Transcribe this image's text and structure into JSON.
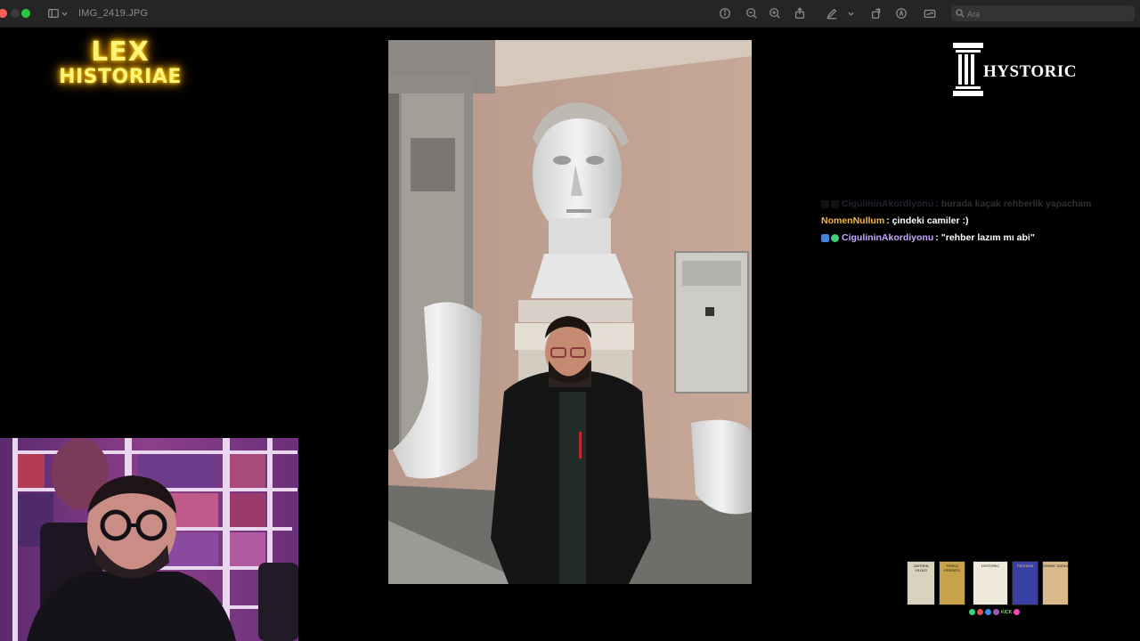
{
  "window": {
    "filename": "IMG_2419.JPG",
    "search_placeholder": "Ara",
    "toolbar_icons": [
      "info-icon",
      "zoom-out-icon",
      "zoom-in-icon",
      "share-icon",
      "markup-pen-icon",
      "rotate-icon",
      "markup-circle-icon",
      "sign-icon"
    ]
  },
  "overlay": {
    "logo_left_line1": "LEX",
    "logo_left_line2": "HISTORIAE",
    "logo_right_text": "HYSTORIC"
  },
  "chat": {
    "messages": [
      {
        "user": "CigulininAkordiyonu",
        "text": "burada kaçak rehberlik yapacham",
        "user_color": "#c7a8ff",
        "faded": true
      },
      {
        "user": "NomenNullum",
        "text": "çindeki camiler :)",
        "user_color": "#f2b84b",
        "faded": false
      },
      {
        "user": "CigulininAkordiyonu",
        "text": "\"rehber lazım mı abi\"",
        "user_color": "#c7a8ff",
        "faded": false
      }
    ],
    "separator": ":"
  },
  "books": {
    "social_label": "KICK",
    "items": [
      {
        "title": "ZAFERIN YILDIZI",
        "color": "#d9d2bf"
      },
      {
        "title": "TÜRKÜ PERDESİ",
        "color": "#c8a24a"
      },
      {
        "title": "HYSTORIC",
        "color": "#efe9dc"
      },
      {
        "title": "FATİHİZM",
        "color": "#3a3fa6"
      },
      {
        "title": "ERKEK TARİHİ",
        "color": "#d9b98a"
      }
    ]
  },
  "colors": {
    "titlebar_bg": "#252526",
    "background": "#000000",
    "logo_glow": "#ffd400",
    "close_button": "#ff5f57",
    "max_button": "#28c840"
  }
}
